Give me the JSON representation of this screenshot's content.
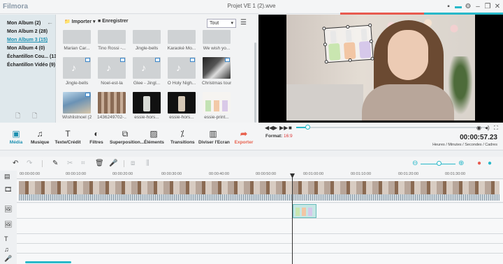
{
  "app": {
    "logo": "Filmora",
    "title": "Projet VE 1 (2).wve"
  },
  "colors": {
    "accent_red": "#e85a4f",
    "accent_teal": "#27b8c9",
    "active_link": "#1b8fb0"
  },
  "albums": [
    {
      "label": "Mon Album (2)"
    },
    {
      "label": "Mon Album 2 (28)"
    },
    {
      "label": "Mon Album 3 (15)",
      "active": true
    },
    {
      "label": "Mon Album 4 (0)"
    },
    {
      "label": "Échantillon Cou... (13)"
    },
    {
      "label": "Échantillon Vidéo (9)"
    }
  ],
  "media": {
    "import_label": "Importer",
    "record_label": "Enregistrer",
    "filter_value": "Tout",
    "items": [
      {
        "label": "Marian Car..."
      },
      {
        "label": "Tino Rossi -..."
      },
      {
        "label": "Jingle-bells"
      },
      {
        "label": "Karaoké Mo..."
      },
      {
        "label": "We wish yo..."
      },
      {
        "label": "Jingle-bells"
      },
      {
        "label": "Noel-est-la"
      },
      {
        "label": "Glee - Jingl..."
      },
      {
        "label": "O Holy Nigh..."
      },
      {
        "label": "Christmas tour"
      },
      {
        "label": "Wishlistnoel (2)"
      },
      {
        "label": "1436249702-..."
      },
      {
        "label": "essie-hors..."
      },
      {
        "label": "essie-hors..."
      },
      {
        "label": "essie-print..."
      }
    ]
  },
  "toolbar": {
    "tools": [
      {
        "label": "Média",
        "icon": "media-icon"
      },
      {
        "label": "Musique",
        "icon": "music-icon"
      },
      {
        "label": "Texte/Crédit",
        "icon": "text-icon"
      },
      {
        "label": "Filtres",
        "icon": "filters-icon"
      },
      {
        "label": "Superposition...",
        "icon": "overlay-icon"
      },
      {
        "label": "Éléments",
        "icon": "elements-icon"
      },
      {
        "label": "Transitions",
        "icon": "transitions-icon"
      },
      {
        "label": "Diviser l'Ecran",
        "icon": "split-screen-icon"
      },
      {
        "label": "Exporter",
        "icon": "export-icon"
      }
    ]
  },
  "player": {
    "format_label": "Format:",
    "format_value": "16:9",
    "timecode": "00:00:57.23",
    "timecode_units": "Heures / Minutes / Secondes / Cadres",
    "progress": 0.06
  },
  "ruler": {
    "ticks": [
      "00:00:00:00",
      "00:00:10:00",
      "00:00:20:00",
      "00:00:30:00",
      "00:00:40:00",
      "00:00:50:00",
      "00:01:00:00",
      "00:01:10:00",
      "00:01:20:00",
      "00:01:30:00"
    ]
  }
}
